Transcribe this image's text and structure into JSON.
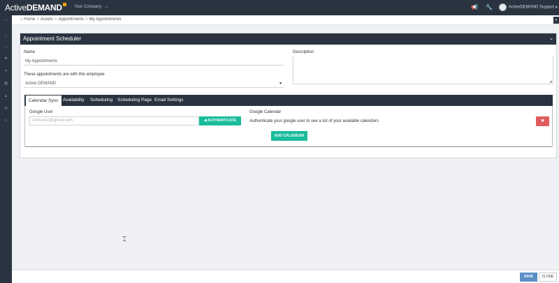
{
  "topbar": {
    "logo_text_light": "Active",
    "logo_text_bold": "DEMAND",
    "company": "Your Company",
    "company_icon": "sitemap-icon",
    "icons": [
      "megaphone-icon",
      "wrench-icon"
    ],
    "user_name": "ActiveDEMAND Support"
  },
  "sidebar": {
    "icons": [
      "menu-icon",
      "home-icon",
      "sitemap-icon",
      "users-icon",
      "handshake-icon",
      "grid-icon",
      "lock-icon",
      "settings-icon",
      "tools-icon"
    ]
  },
  "breadcrumb": {
    "items": [
      "Home",
      "Assets",
      "Appointments",
      "My Appointments"
    ]
  },
  "panel": {
    "title": "Appointment Scheduler",
    "name_label": "Name",
    "name_value": "My Appointments",
    "employee_label": "These appointments are with this employee",
    "employee_value": "Active DEMAND",
    "description_label": "Description",
    "description_value": ""
  },
  "tabs": [
    {
      "label": "Calendar Sync",
      "active": true
    },
    {
      "label": "Availability",
      "active": false
    },
    {
      "label": "Scheduling",
      "active": false
    },
    {
      "label": "Scheduling Page",
      "active": false
    },
    {
      "label": "Email Settings",
      "active": false
    }
  ],
  "calendar_sync": {
    "google_user_label": "Google User",
    "google_user_placeholder": "someone@gmail.com",
    "authenticate_label": "AUTHENTICATE",
    "google_calendar_label": "Google Calendar",
    "auth_message": "Authenticate your google user to see a list of your available calendars",
    "add_calendar_label": "ADD CALENDAR"
  },
  "footer": {
    "save_label": "SAVE",
    "close_label": "CLOSE"
  }
}
